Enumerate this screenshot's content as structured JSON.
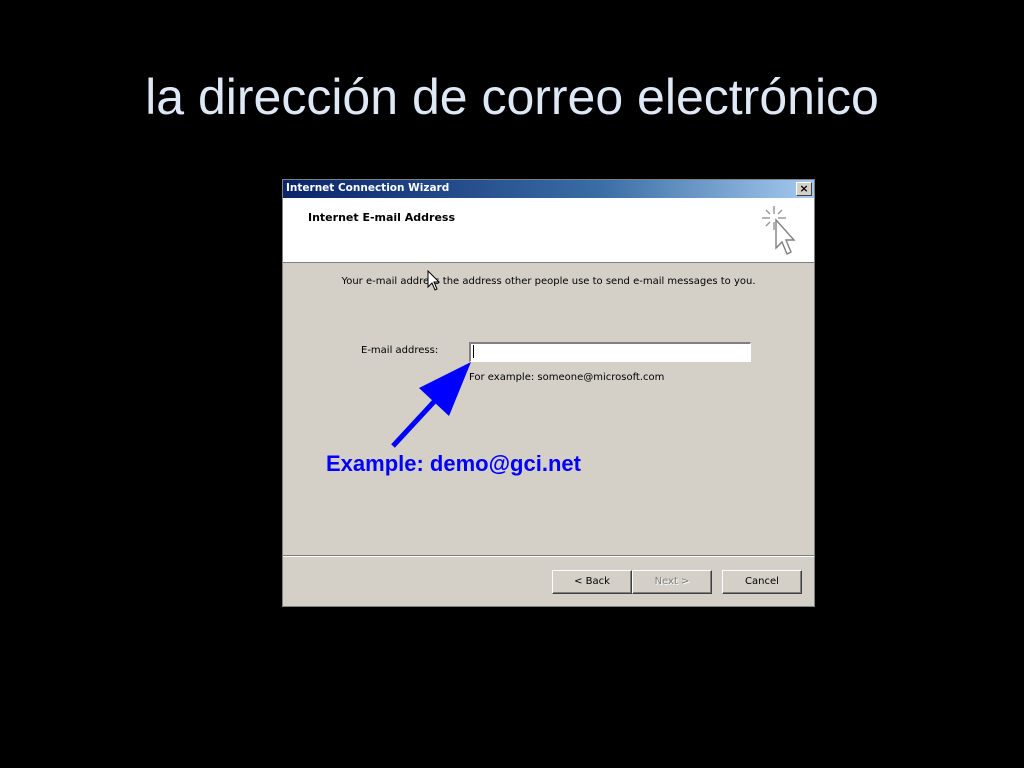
{
  "slide": {
    "title": "la dirección de correo electrónico"
  },
  "window": {
    "title": "Internet Connection Wizard",
    "close_label": "×"
  },
  "header": {
    "title": "Internet E-mail Address",
    "icon": "wizard-cursor-icon"
  },
  "body": {
    "description": "Your e-mail address  the address other people use to send e-mail messages to you.",
    "email_label": "E-mail address:",
    "email_value": "",
    "email_example": "For example: someone@microsoft.com"
  },
  "annotation": {
    "text": "Example: demo@gci.net",
    "color": "#0000ff"
  },
  "buttons": {
    "back": "< Back",
    "next": "Next >",
    "cancel": "Cancel"
  },
  "colors": {
    "titlebar_start": "#0a246a",
    "dialog_face": "#d4d0c8",
    "slide_background": "#000000",
    "slide_title": "#dfe8f5"
  }
}
